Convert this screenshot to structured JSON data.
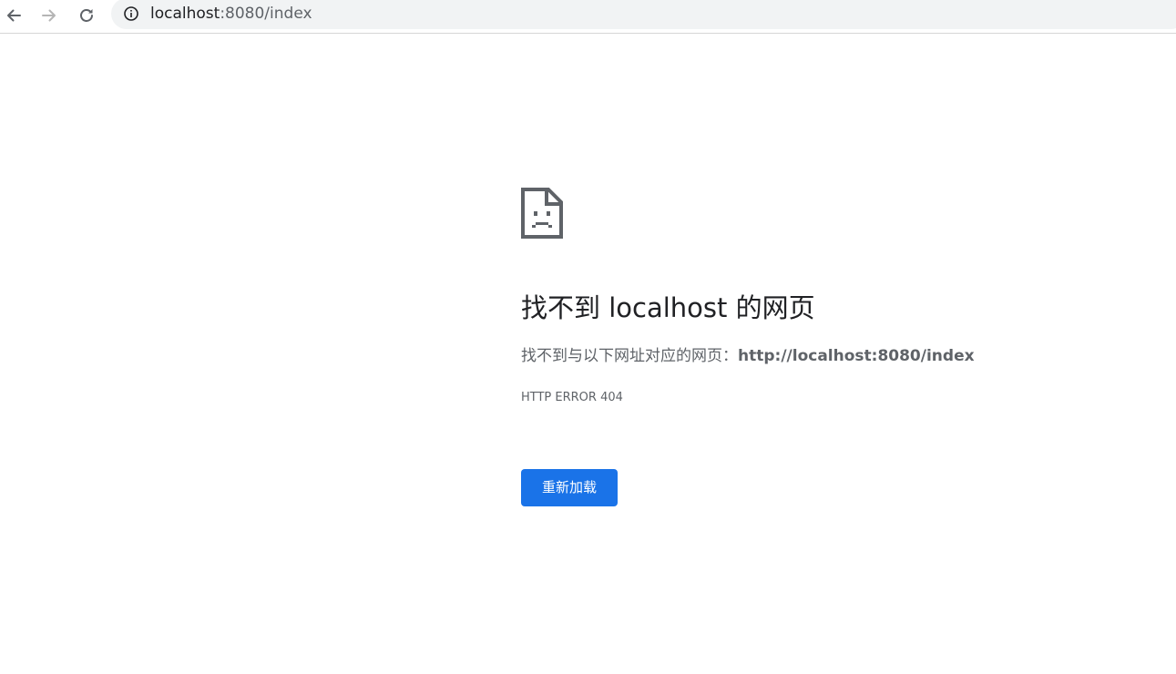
{
  "browser": {
    "url_host": "localhost",
    "url_rest": ":8080/index",
    "icons": {
      "back": "back-arrow-icon",
      "forward": "forward-arrow-icon",
      "reload": "reload-icon",
      "info": "info-icon"
    }
  },
  "error_page": {
    "icon": "sad-document-icon",
    "headline": "找不到 localhost 的网页",
    "description_prefix": "找不到与以下网址对应的网页：",
    "description_url": "http://localhost:8080/index",
    "error_code": "HTTP ERROR 404",
    "reload_label": "重新加载"
  },
  "colors": {
    "accent": "#1a73e8",
    "text_primary": "#202124",
    "text_secondary": "#5f6368",
    "omnibox_bg": "#f1f3f4"
  }
}
